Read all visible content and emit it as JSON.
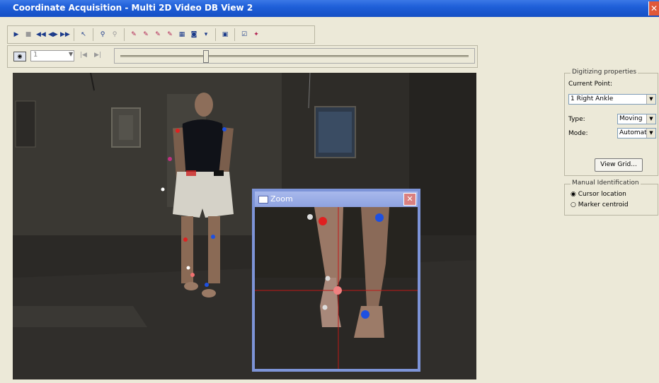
{
  "window": {
    "title": "Coordinate Acquisition - Multi 2D Video DB View 2",
    "close_glyph": "✕"
  },
  "toolbar": {
    "icons": [
      "play-icon",
      "stop-icon",
      "rewind-icon",
      "step-back-icon",
      "step-forward-icon",
      "cursor-icon",
      "marker-tool-icon",
      "marker-tool-2-icon",
      "pen-icon",
      "pen-2-icon",
      "pen-3-icon",
      "pen-multi-icon",
      "grid-icon",
      "camera-icon",
      "dropdown-arrow-icon",
      "window-icon",
      "check-icon",
      "link-icon"
    ]
  },
  "frame": {
    "value": "1"
  },
  "zoom": {
    "title": "Zoom",
    "close_glyph": "✕"
  },
  "digitizing": {
    "group_label": "Digitizing properties",
    "current_point_label": "Current Point:",
    "current_point_value": "1 Right Ankle",
    "type_label": "Type:",
    "type_value": "Moving",
    "mode_label": "Mode:",
    "mode_value": "Automatic",
    "view_grid_button": "View Grid..."
  },
  "manual": {
    "group_label": "Manual Identification",
    "options": [
      "Cursor location",
      "Marker centroid"
    ],
    "selected_index": 0
  },
  "slider": {
    "position_fraction": 0.24
  },
  "colors": {
    "title_blue": "#1f5fd8",
    "window_bg": "#ece9d8",
    "zoom_border": "#7d94d8",
    "marker_red": "#e02020",
    "marker_blue": "#1e50e0"
  }
}
